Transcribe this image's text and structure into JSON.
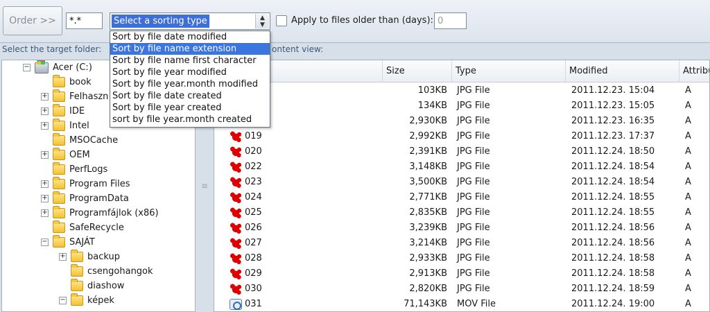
{
  "toolbar": {
    "order_label": "Order >>",
    "mask_value": "*.*",
    "sort_placeholder": "Select a sorting type",
    "older_label": "Apply to files older than (days):",
    "days_value": "0"
  },
  "sort_options": [
    "Sort by file date modified",
    "Sort by file name extension",
    "Sort by file name first character",
    "Sort by file year modified",
    "Sort by file year.month modified",
    "Sort by file date created",
    "Sort by file year created",
    "sort by file year.month created"
  ],
  "sort_selected_index": 1,
  "captions": {
    "target_folder": "Select the target folder:",
    "content_view": "ontent view:"
  },
  "tree": {
    "drive_label": "Acer (C:)",
    "items": [
      {
        "label": "book",
        "expander": ""
      },
      {
        "label": "Felhaszn",
        "expander": "+"
      },
      {
        "label": "IDE",
        "expander": "+"
      },
      {
        "label": "Intel",
        "expander": "+"
      },
      {
        "label": "MSOCache",
        "expander": ""
      },
      {
        "label": "OEM",
        "expander": "+"
      },
      {
        "label": "PerfLogs",
        "expander": ""
      },
      {
        "label": "Program Files",
        "expander": "+"
      },
      {
        "label": "ProgramData",
        "expander": "+"
      },
      {
        "label": "Programfájlok (x86)",
        "expander": "+"
      },
      {
        "label": "SafeRecycle",
        "expander": ""
      },
      {
        "label": "SAJÁT",
        "expander": "−"
      }
    ],
    "subitems": [
      {
        "label": "backup",
        "expander": "+"
      },
      {
        "label": "csengohangok",
        "expander": ""
      },
      {
        "label": "diashow",
        "expander": ""
      },
      {
        "label": "képek",
        "expander": "−"
      }
    ]
  },
  "filelist": {
    "columns": [
      "Size",
      "Type",
      "Modified",
      "Attribu"
    ],
    "rows": [
      {
        "name": "",
        "size": "103KB",
        "type": "JPG File",
        "modified": "2011.12.23. 15:04",
        "attr": "A",
        "icon": "jpg"
      },
      {
        "name": "",
        "size": "134KB",
        "type": "JPG File",
        "modified": "2011.12.23. 15:05",
        "attr": "A",
        "icon": "jpg"
      },
      {
        "name": "",
        "size": "2,930KB",
        "type": "JPG File",
        "modified": "2011.12.23. 16:35",
        "attr": "A",
        "icon": "jpg"
      },
      {
        "name": "019",
        "size": "2,992KB",
        "type": "JPG File",
        "modified": "2011.12.23. 17:37",
        "attr": "A",
        "icon": "jpg"
      },
      {
        "name": "020",
        "size": "2,391KB",
        "type": "JPG File",
        "modified": "2011.12.24. 18:50",
        "attr": "A",
        "icon": "jpg"
      },
      {
        "name": "022",
        "size": "3,148KB",
        "type": "JPG File",
        "modified": "2011.12.24. 18:54",
        "attr": "A",
        "icon": "jpg"
      },
      {
        "name": "023",
        "size": "3,500KB",
        "type": "JPG File",
        "modified": "2011.12.24. 18:54",
        "attr": "A",
        "icon": "jpg"
      },
      {
        "name": "024",
        "size": "2,771KB",
        "type": "JPG File",
        "modified": "2011.12.24. 18:55",
        "attr": "A",
        "icon": "jpg"
      },
      {
        "name": "025",
        "size": "2,835KB",
        "type": "JPG File",
        "modified": "2011.12.24. 18:55",
        "attr": "A",
        "icon": "jpg"
      },
      {
        "name": "026",
        "size": "3,239KB",
        "type": "JPG File",
        "modified": "2011.12.24. 18:56",
        "attr": "A",
        "icon": "jpg"
      },
      {
        "name": "027",
        "size": "3,214KB",
        "type": "JPG File",
        "modified": "2011.12.24. 18:56",
        "attr": "A",
        "icon": "jpg"
      },
      {
        "name": "028",
        "size": "2,933KB",
        "type": "JPG File",
        "modified": "2011.12.24. 18:58",
        "attr": "A",
        "icon": "jpg"
      },
      {
        "name": "029",
        "size": "2,913KB",
        "type": "JPG File",
        "modified": "2011.12.24. 18:58",
        "attr": "A",
        "icon": "jpg"
      },
      {
        "name": "030",
        "size": "2,820KB",
        "type": "JPG File",
        "modified": "2011.12.24. 18:59",
        "attr": "A",
        "icon": "jpg"
      },
      {
        "name": "031",
        "size": "71,143KB",
        "type": "MOV File",
        "modified": "2011.12.24. 19:00",
        "attr": "A",
        "icon": "mov"
      }
    ]
  }
}
